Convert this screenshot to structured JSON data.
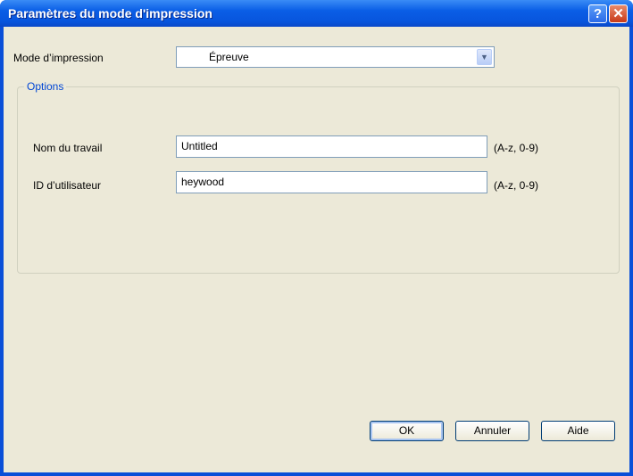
{
  "window": {
    "title": "Paramètres du mode d'impression",
    "help_label": "?",
    "close_label": "✕"
  },
  "mode": {
    "label": "Mode d’impression",
    "value": "Épreuve"
  },
  "options": {
    "legend": "Options",
    "job_name": {
      "label": "Nom du travail",
      "value": "Untitled",
      "hint": "(A-z, 0-9)"
    },
    "user_id": {
      "label": "ID d’utilisateur",
      "value": "heywood",
      "hint": "(A-z, 0-9)"
    }
  },
  "buttons": {
    "ok": "OK",
    "cancel": "Annuler",
    "help": "Aide"
  }
}
